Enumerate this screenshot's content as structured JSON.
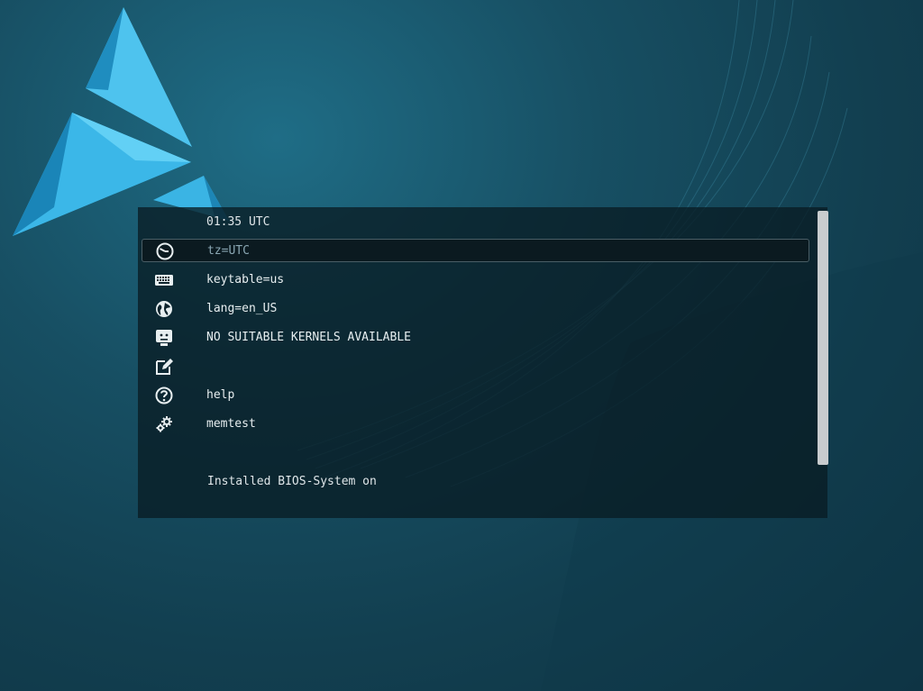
{
  "header": {
    "clock": "01:35 UTC"
  },
  "menu": {
    "items": [
      {
        "label": "tz=UTC",
        "icon": "clock-icon",
        "selected": true
      },
      {
        "label": "keytable=us",
        "icon": "keyboard-icon",
        "selected": false
      },
      {
        "label": "lang=en_US",
        "icon": "globe-icon",
        "selected": false
      },
      {
        "label": "NO SUITABLE KERNELS AVAILABLE",
        "icon": "sad-monitor-icon",
        "selected": false
      },
      {
        "label": "",
        "icon": "edit-icon",
        "selected": false
      },
      {
        "label": "help",
        "icon": "help-icon",
        "selected": false
      },
      {
        "label": "memtest",
        "icon": "gears-icon",
        "selected": false
      }
    ]
  },
  "footer": {
    "text": "Installed BIOS-System on"
  },
  "colors": {
    "background": "#174f63",
    "panel": "#091c24",
    "text": "#e7eef0",
    "selected_text": "#8aa7b3",
    "logo_accent": "#29a8dc"
  }
}
